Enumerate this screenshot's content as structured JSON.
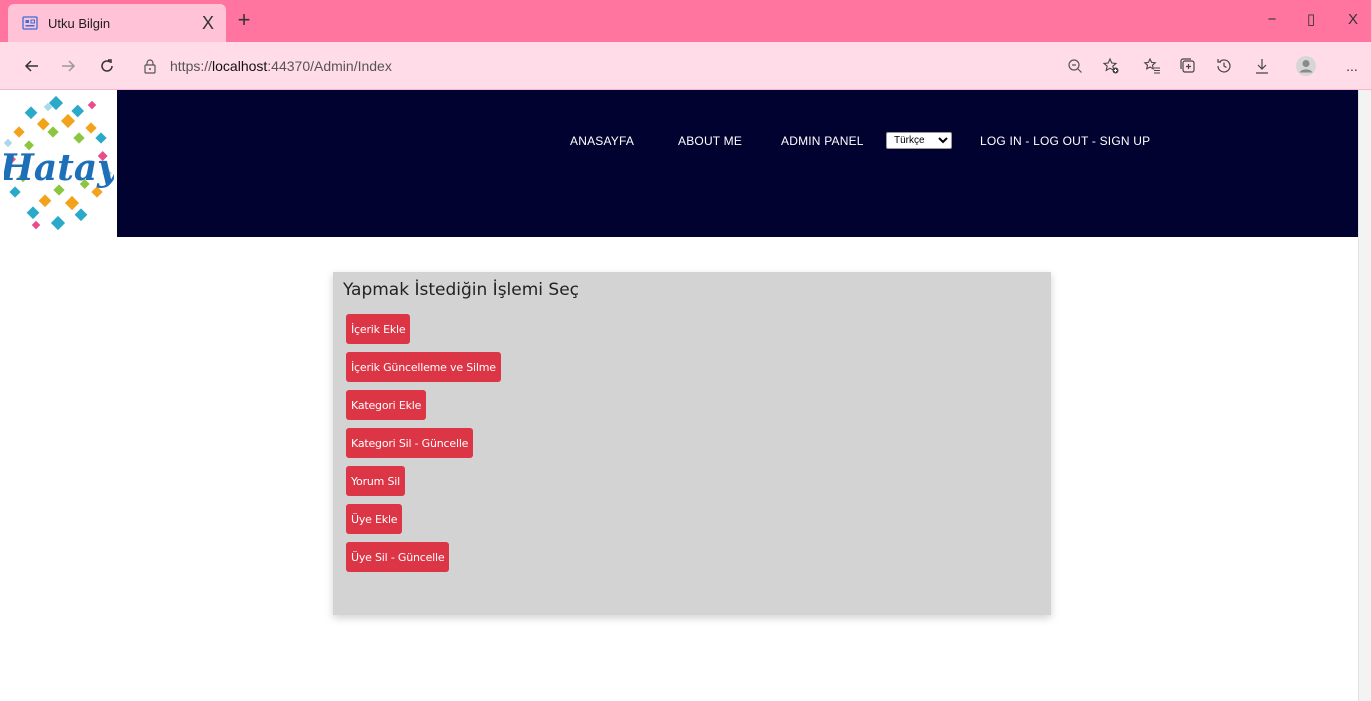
{
  "browser": {
    "tab_title": "Utku Bilgin",
    "tab_close": "X",
    "new_tab": "+",
    "url_prefix": "https://",
    "url_host": "localhost",
    "url_rest": ":44370/Admin/Index",
    "window_controls": {
      "minimize": "−",
      "restore": "▯",
      "close": "X"
    },
    "menu": "..."
  },
  "header": {
    "logo_text": "Hatay",
    "nav": [
      {
        "label": "ANASAYFA"
      },
      {
        "label": "ABOUT ME"
      },
      {
        "label": "ADMIN PANEL"
      },
      {
        "label": "LOG IN - LOG OUT - SIGN UP"
      }
    ],
    "language": {
      "selected": "Türkçe"
    }
  },
  "panel": {
    "title": "Yapmak İstediğin İşlemi Seç",
    "buttons": [
      {
        "label": "İçerik Ekle"
      },
      {
        "label": "İçerik Güncelleme ve Silme"
      },
      {
        "label": "Kategori Ekle"
      },
      {
        "label": "Kategori Sil - Güncelle"
      },
      {
        "label": "Yorum Sil"
      },
      {
        "label": "Üye Ekle"
      },
      {
        "label": "Üye Sil - Güncelle"
      }
    ]
  },
  "colors": {
    "tabbar": "#ff75a0",
    "addressbar": "#ffdce8",
    "navband": "#020230",
    "panel": "#d3d3d3",
    "button": "#dc3545"
  }
}
